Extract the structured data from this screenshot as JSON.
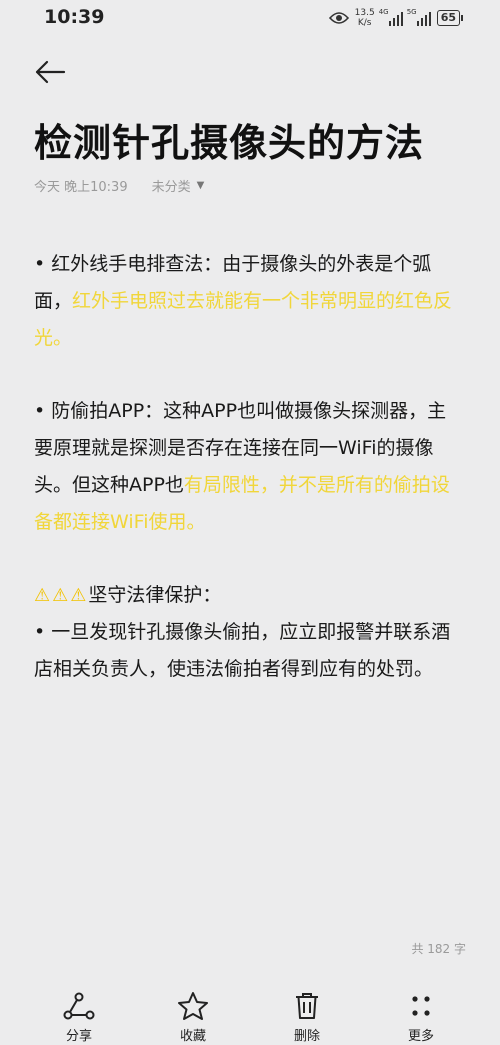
{
  "status_bar": {
    "time": "10:39",
    "net_speed_value": "13.5",
    "net_speed_unit": "K/s",
    "signal1_label": "4G",
    "signal2_label": "5G",
    "battery": "65"
  },
  "note": {
    "title": "检测针孔摄像头的方法",
    "date": "今天 晚上10:39",
    "category": "未分类",
    "p1_normal": "• 红外线手电排查法：由于摄像头的外表是个弧面，",
    "p1_highlight": "红外手电照过去就能有一个非常明显的红色反光。",
    "p2_normal": "• 防偷拍APP：这种APP也叫做摄像头探测器，主要原理就是探测是否存在连接在同一WiFi的摄像头。但这种APP也",
    "p2_highlight": "有局限性，并不是所有的偷拍设备都连接WiFi使用。",
    "p3_heading": "坚守法律保护：",
    "p3_body": "• 一旦发现针孔摄像头偷拍，应立即报警并联系酒店相关负责人，使违法偷拍者得到应有的处罚。",
    "warn_icons": [
      "⚠",
      "⚠",
      "⚠"
    ],
    "word_count": "共 182 字"
  },
  "toolbar": {
    "share": "分享",
    "favorite": "收藏",
    "delete": "删除",
    "more": "更多"
  },
  "colors": {
    "highlight": "#f1d63a",
    "background": "#ececed",
    "warning": "#f2c200"
  }
}
